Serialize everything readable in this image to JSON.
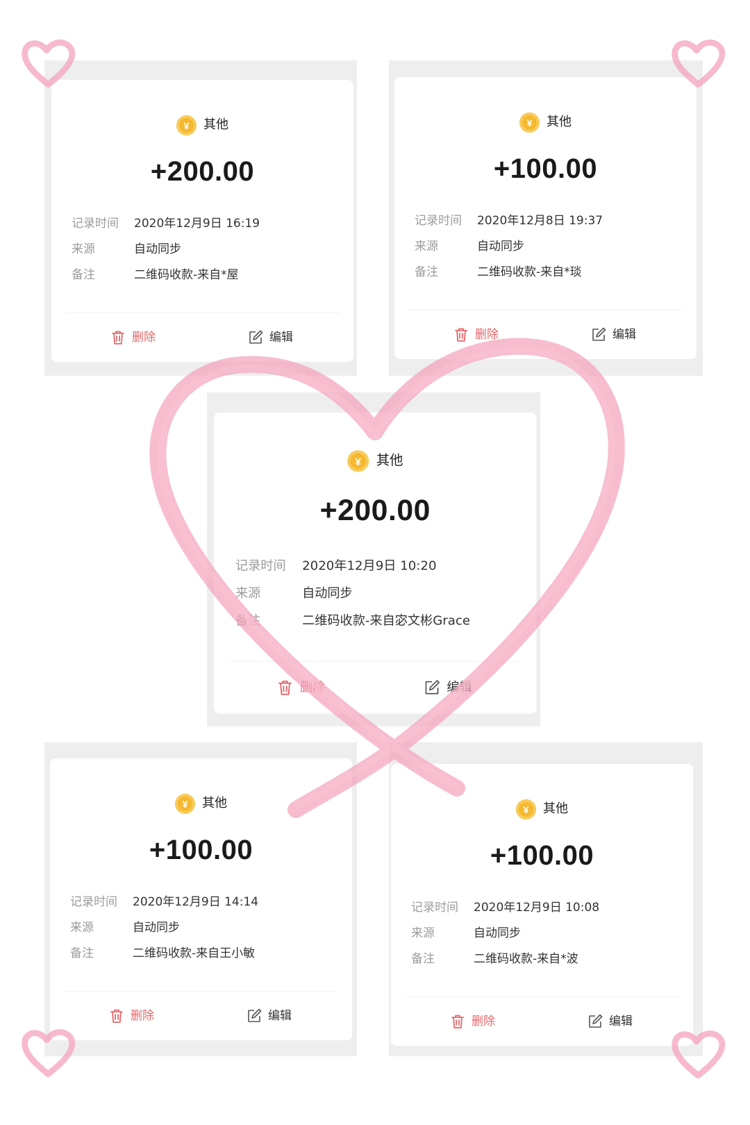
{
  "records": [
    {
      "category": "其他",
      "coin_symbol": "¥",
      "amount": "+200.00",
      "time_label": "记录时间",
      "time": "2020年12月9日 16:19",
      "source_label": "来源",
      "source": "自动同步",
      "note_label": "备注",
      "note": "二维码收款-来自*屋",
      "delete_label": "删除",
      "edit_label": "编辑"
    },
    {
      "category": "其他",
      "coin_symbol": "¥",
      "amount": "+100.00",
      "time_label": "记录时间",
      "time": "2020年12月8日 19:37",
      "source_label": "来源",
      "source": "自动同步",
      "note_label": "备注",
      "note": "二维码收款-来自*琰",
      "delete_label": "删除",
      "edit_label": "编辑"
    },
    {
      "category": "其他",
      "coin_symbol": "¥",
      "amount": "+200.00",
      "time_label": "记录时间",
      "time": "2020年12月9日 10:20",
      "source_label": "来源",
      "source": "自动同步",
      "note_label": "备注",
      "note": "二维码收款-来自宓文彬Grace",
      "delete_label": "删除",
      "edit_label": "编辑"
    },
    {
      "category": "其他",
      "coin_symbol": "¥",
      "amount": "+100.00",
      "time_label": "记录时间",
      "time": "2020年12月9日 14:14",
      "source_label": "来源",
      "source": "自动同步",
      "note_label": "备注",
      "note": "二维码收款-来自王小敏",
      "delete_label": "删除",
      "edit_label": "编辑"
    },
    {
      "category": "其他",
      "coin_symbol": "¥",
      "amount": "+100.00",
      "time_label": "记录时间",
      "time": "2020年12月9日 10:08",
      "source_label": "来源",
      "source": "自动同步",
      "note_label": "备注",
      "note": "二维码收款-来自*波",
      "delete_label": "删除",
      "edit_label": "编辑"
    }
  ],
  "colors": {
    "coin": "#F5B82E",
    "delete": "#E5676A",
    "amount": "#1A1A1A",
    "label": "#9B9B9B",
    "value": "#333333",
    "frame": "#EEEEEE",
    "heart_doodle": "#F4A3BC"
  },
  "icons": {
    "category": "coin-icon",
    "delete": "trash-icon",
    "edit": "edit-icon",
    "decoration": "heart-doodle"
  }
}
